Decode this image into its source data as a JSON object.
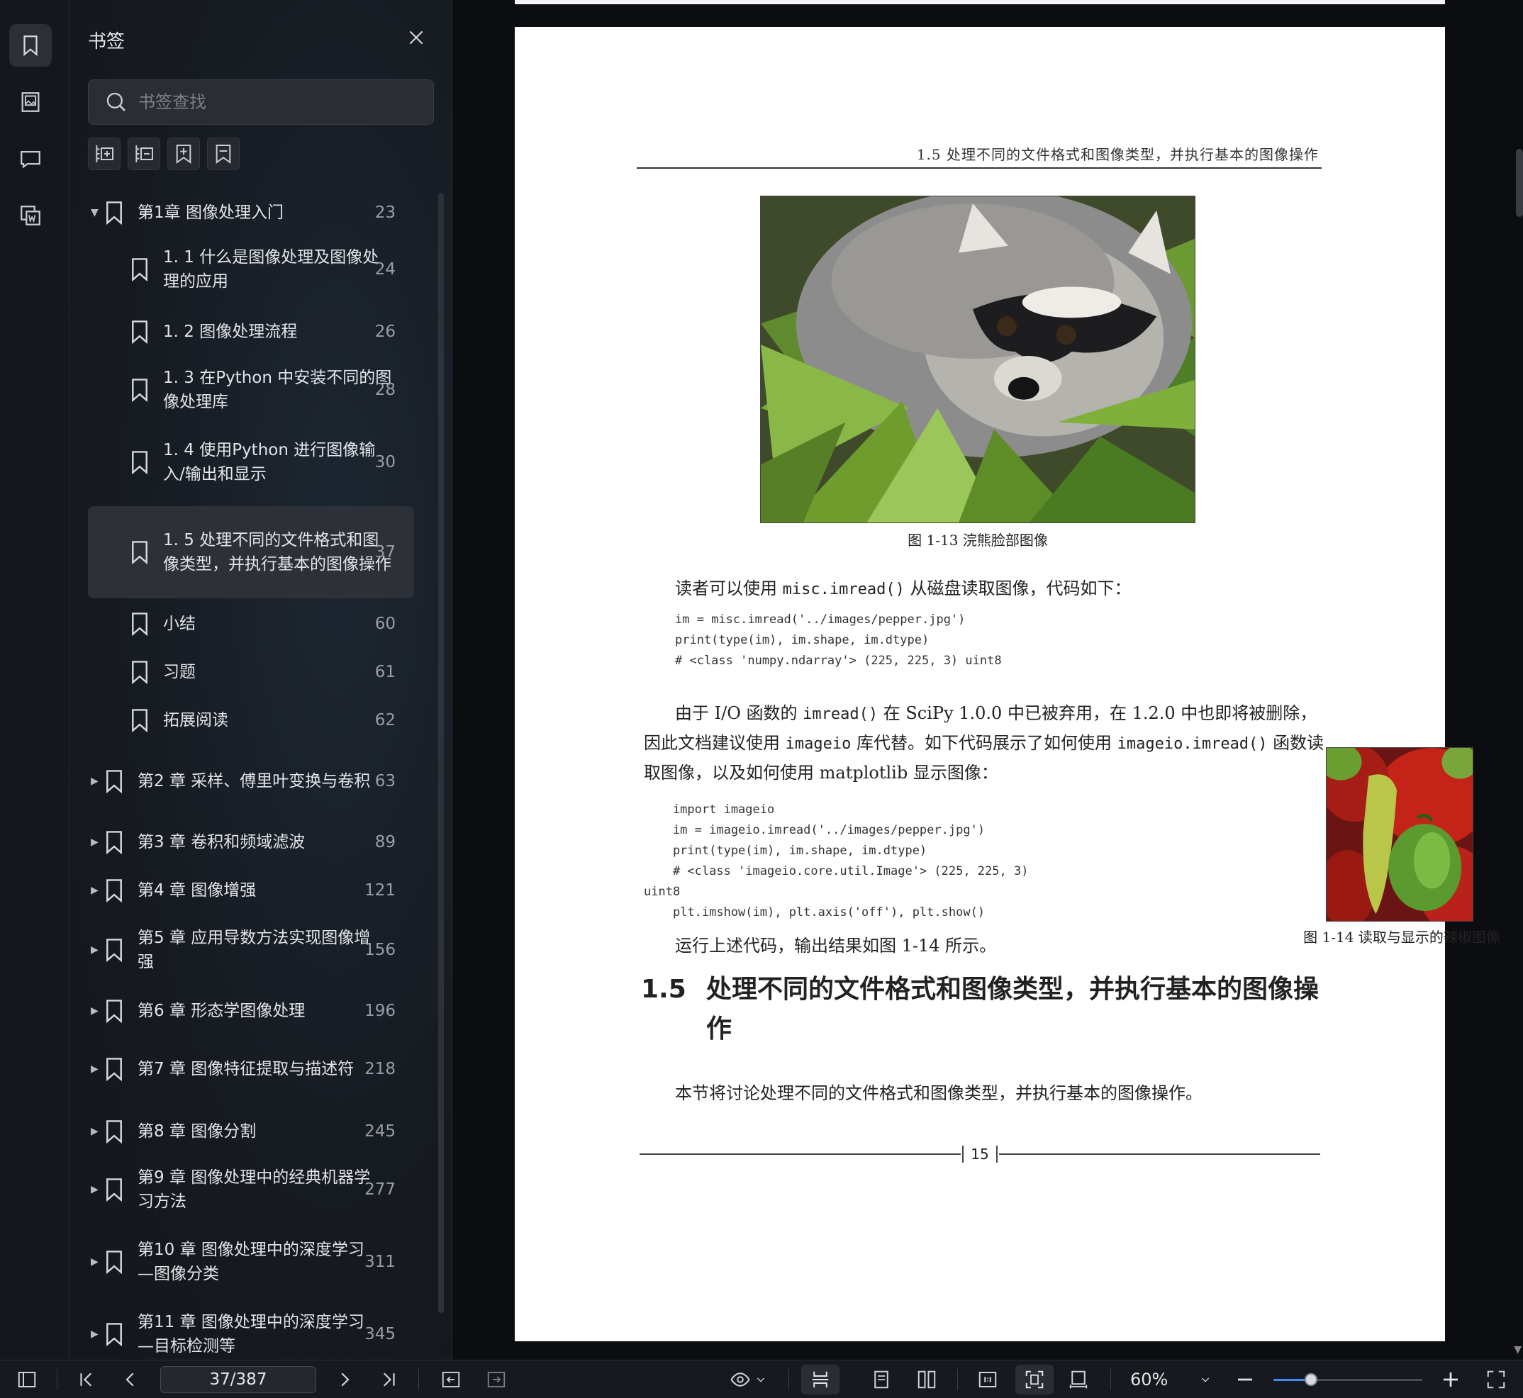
{
  "sidebar": {
    "title": "书签",
    "search_placeholder": "书签查找",
    "items": [
      {
        "label": "第1章  图像处理入门",
        "page": "23",
        "level": 0,
        "expanded": true
      },
      {
        "label": "1. 1   什么是图像处理及图像处理的应用",
        "page": "24",
        "level": 1
      },
      {
        "label": "1. 2   图像处理流程",
        "page": "26",
        "level": 1
      },
      {
        "label": "1. 3   在Python 中安装不同的图像处理库",
        "page": "28",
        "level": 1
      },
      {
        "label": "1. 4   使用Python 进行图像输入/输出和显示",
        "page": "30",
        "level": 1
      },
      {
        "label": "1. 5   处理不同的文件格式和图像类型，并执行基本的图像操作",
        "page": "37",
        "level": 1,
        "active": true
      },
      {
        "label": "小结",
        "page": "60",
        "level": 1
      },
      {
        "label": "习题",
        "page": "61",
        "level": 1
      },
      {
        "label": "拓展阅读",
        "page": "62",
        "level": 1
      },
      {
        "label": " 第2   章 采样、傅里叶变换与卷积",
        "page": "63",
        "level": 0
      },
      {
        "label": " 第3   章 卷积和频域滤波",
        "page": "89",
        "level": 0
      },
      {
        "label": " 第4   章 图像增强",
        "page": "121",
        "level": 0
      },
      {
        "label": " 第5   章 应用导数方法实现图像增强",
        "page": "156",
        "level": 0
      },
      {
        "label": " 第6   章 形态学图像处理",
        "page": "196",
        "level": 0
      },
      {
        "label": " 第7   章 图像特征提取与描述符",
        "page": "218",
        "level": 0
      },
      {
        "label": " 第8   章 图像分割",
        "page": "245",
        "level": 0
      },
      {
        "label": " 第9   章 图像处理中的经典机器学习方法",
        "page": "277",
        "level": 0
      },
      {
        "label": " 第10   章 图像处理中的深度学习—图像分类",
        "page": "311",
        "level": 0
      },
      {
        "label": " 第11   章 图像处理中的深度学习—目标检测等",
        "page": "345",
        "level": 0
      }
    ]
  },
  "doc": {
    "running_head": "1.5   处理不同的文件格式和图像类型，并执行基本的图像操作",
    "fig1_caption": "图 1-13    浣熊脸部图像",
    "para1_a": "读者可以使用 ",
    "para1_code": "misc.imread()",
    "para1_b": " 从磁盘读取图像，代码如下：",
    "code1": "im = misc.imread('../images/pepper.jpg')\nprint(type(im), im.shape, im.dtype)\n# <class 'numpy.ndarray'> (225, 225, 3) uint8",
    "para2_a": "由于 I/O 函数的 ",
    "para2_code1": "imread()",
    "para2_b": " 在 SciPy 1.0.0 中已被弃用，在 1.2.0 中也即将被删除，因此文档建议使用 ",
    "para2_code2": "imageio",
    "para2_c": " 库代替。如下代码展示了如何使用 ",
    "para2_code3": "imageio.imread()",
    "para2_d": " 函数读取图像，以及如何使用 matplotlib 显示图像：",
    "code2": "    import imageio\n    im = imageio.imread('../images/pepper.jpg')\n    print(type(im), im.shape, im.dtype)\n    # <class 'imageio.core.util.Image'> (225, 225, 3)\nuint8\n    plt.imshow(im), plt.axis('off'), plt.show()",
    "para3": "运行上述代码，输出结果如图 1-14 所示。",
    "fig2_caption": "图 1-14    读取与显示的辣椒图像",
    "section_number": "1.5",
    "section_title": "处理不同的文件格式和图像类型，并执行基本的图像操作",
    "para4": "本节将讨论处理不同的文件格式和图像类型，并执行基本的图像操作。",
    "page_number": "15"
  },
  "bottombar": {
    "page_indicator": "37/387",
    "zoom": "60%",
    "zoom_fraction": 0.25
  },
  "colors": {
    "accent": "#3a8bff",
    "panel_bg": "#161a20",
    "active_item": "#2d3037"
  }
}
